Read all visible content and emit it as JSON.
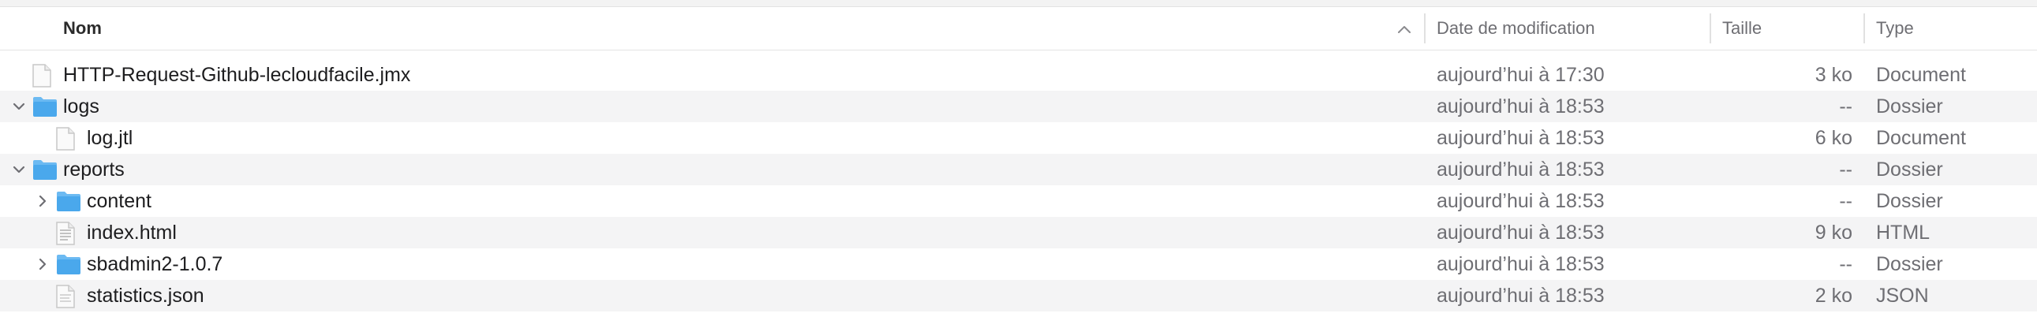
{
  "columns": {
    "name": "Nom",
    "date": "Date de modification",
    "size": "Taille",
    "type": "Type"
  },
  "colors": {
    "folder": "#4aa8ec",
    "folder_tab": "#6cbaf2",
    "row_alt": "#f4f4f5",
    "secondary_text": "#6e6e73"
  },
  "rows": [
    {
      "name": "HTTP-Request-Github-lecloudfacile.jmx",
      "date": "aujourd’hui à 17:30",
      "size": "3 ko",
      "type": "Document",
      "icon": "document-icon",
      "disclosure": "none"
    },
    {
      "name": "logs",
      "date": "aujourd’hui à 18:53",
      "size": "--",
      "type": "Dossier",
      "icon": "folder-icon",
      "disclosure": "expanded"
    },
    {
      "name": "log.jtl",
      "date": "aujourd’hui à 18:53",
      "size": "6 ko",
      "type": "Document",
      "icon": "document-icon",
      "disclosure": "none"
    },
    {
      "name": "reports",
      "date": "aujourd’hui à 18:53",
      "size": "--",
      "type": "Dossier",
      "icon": "folder-icon",
      "disclosure": "expanded"
    },
    {
      "name": "content",
      "date": "aujourd’hui à 18:53",
      "size": "--",
      "type": "Dossier",
      "icon": "folder-icon",
      "disclosure": "collapsed"
    },
    {
      "name": "index.html",
      "date": "aujourd’hui à 18:53",
      "size": "9 ko",
      "type": "HTML",
      "icon": "html-document-icon",
      "disclosure": "none"
    },
    {
      "name": "sbadmin2-1.0.7",
      "date": "aujourd’hui à 18:53",
      "size": "--",
      "type": "Dossier",
      "icon": "folder-icon",
      "disclosure": "collapsed"
    },
    {
      "name": "statistics.json",
      "date": "aujourd’hui à 18:53",
      "size": "2 ko",
      "type": "JSON",
      "icon": "json-document-icon",
      "disclosure": "none"
    }
  ]
}
